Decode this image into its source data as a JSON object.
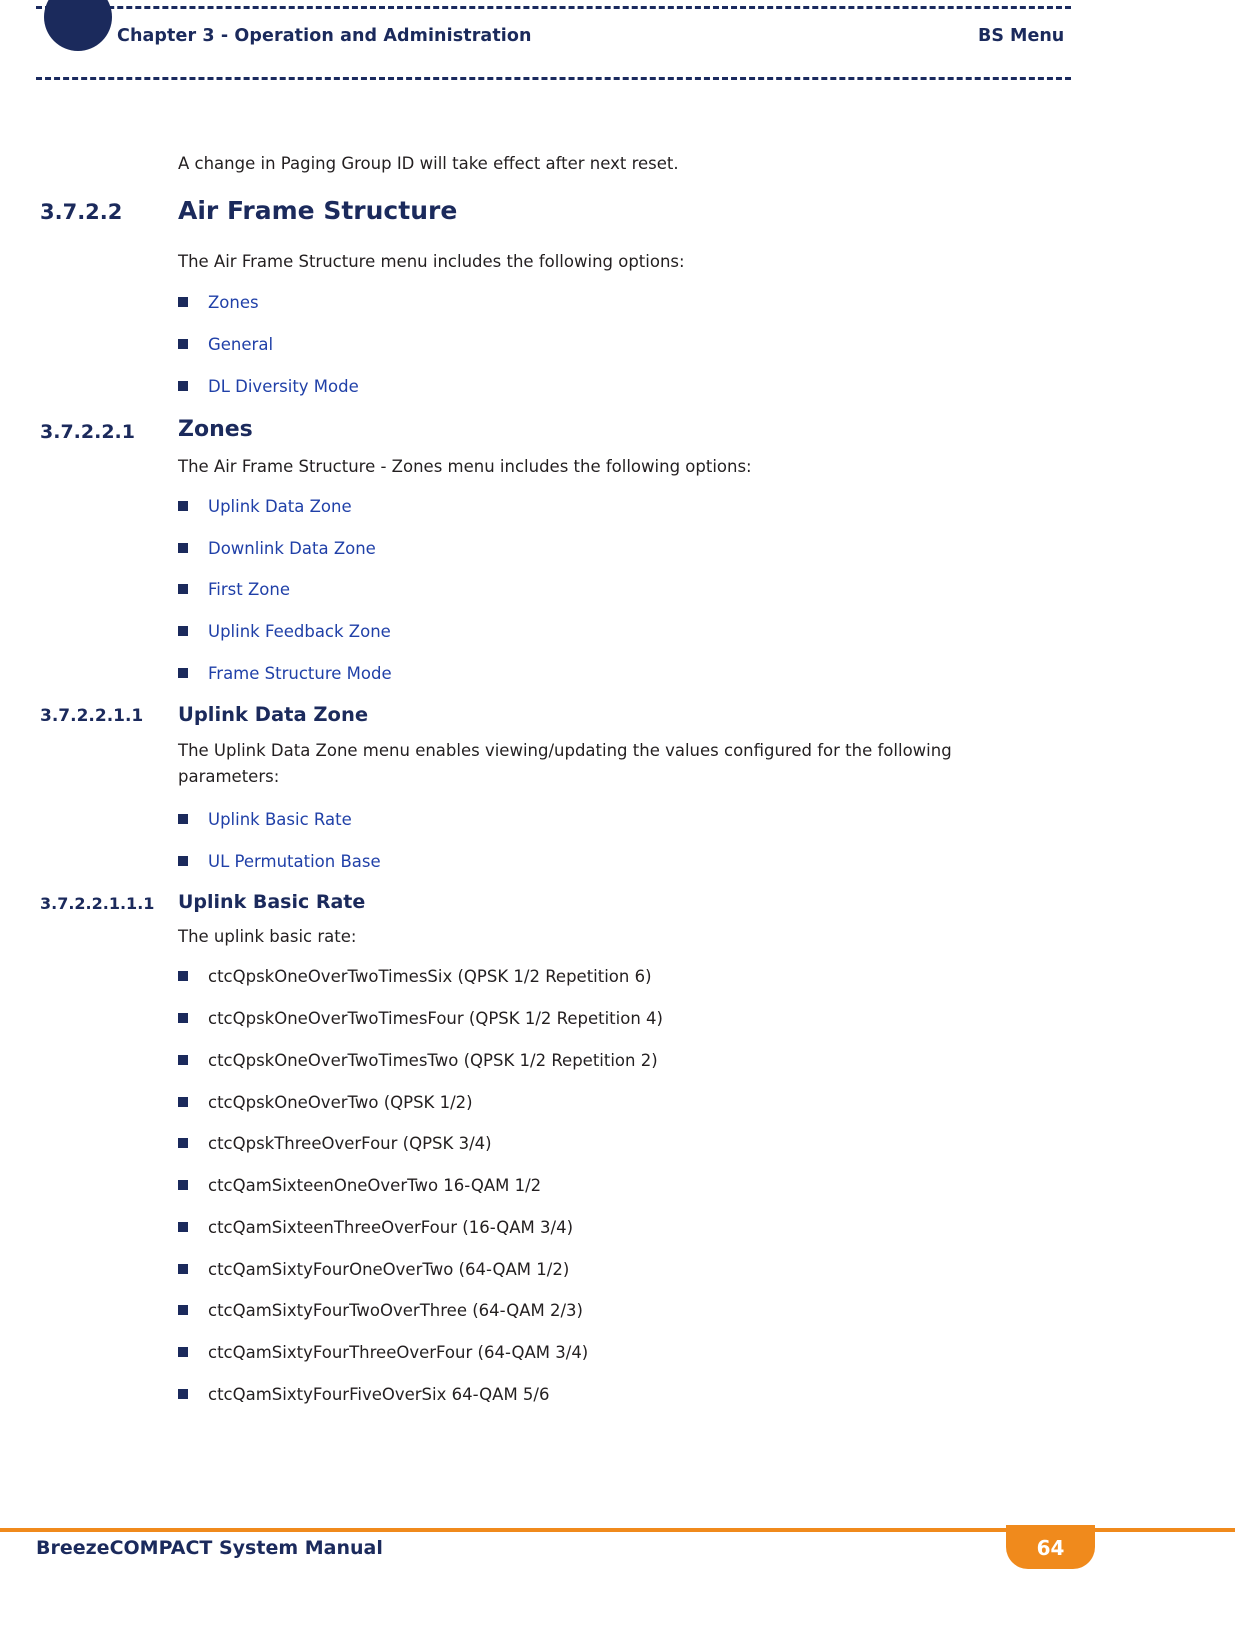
{
  "header": {
    "chapter": "Chapter 3 - Operation and Administration",
    "right": "BS Menu"
  },
  "intro_note": "A change in Paging Group ID will take effect after next reset.",
  "sections": {
    "air_frame": {
      "number": "3.7.2.2",
      "title": "Air Frame Structure",
      "intro": "The Air Frame Structure menu includes the following options:",
      "options": [
        "Zones",
        "General",
        "DL Diversity Mode"
      ]
    },
    "zones": {
      "number": "3.7.2.2.1",
      "title": "Zones",
      "intro": "The Air Frame Structure - Zones menu includes the following options:",
      "options": [
        "Uplink Data Zone",
        "Downlink Data Zone",
        "First Zone",
        "Uplink Feedback Zone",
        "Frame Structure Mode"
      ]
    },
    "uplink_data_zone": {
      "number": "3.7.2.2.1.1",
      "title": "Uplink Data Zone",
      "intro_line1": "The Uplink Data Zone menu enables viewing/updating the values configured for the following",
      "intro_line2": "parameters:",
      "options": [
        "Uplink Basic Rate",
        "UL Permutation Base"
      ]
    },
    "uplink_basic_rate": {
      "number": "3.7.2.2.1.1.1",
      "title": "Uplink Basic Rate",
      "intro": "The uplink basic rate:",
      "options": [
        "ctcQpskOneOverTwoTimesSix (QPSK 1/2 Repetition 6)",
        "ctcQpskOneOverTwoTimesFour (QPSK 1/2 Repetition 4)",
        "ctcQpskOneOverTwoTimesTwo (QPSK 1/2 Repetition 2)",
        "ctcQpskOneOverTwo (QPSK 1/2)",
        "ctcQpskThreeOverFour (QPSK 3/4)",
        "ctcQamSixteenOneOverTwo 16-QAM 1/2",
        "ctcQamSixteenThreeOverFour (16-QAM 3/4)",
        "ctcQamSixtyFourOneOverTwo (64-QAM 1/2)",
        "ctcQamSixtyFourTwoOverThree (64-QAM 2/3)",
        "ctcQamSixtyFourThreeOverFour (64-QAM 3/4)",
        "ctcQamSixtyFourFiveOverSix 64-QAM 5/6"
      ]
    }
  },
  "footer": {
    "title": "BreezeCOMPACT System Manual",
    "page": "64"
  },
  "colors": {
    "navy": "#1b2a5c",
    "link": "#2040a8",
    "orange": "#f08a1c",
    "text": "#231f20"
  }
}
